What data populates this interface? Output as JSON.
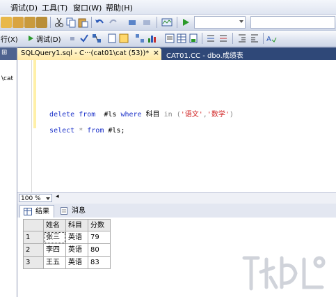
{
  "menu": [
    {
      "label": "调试(D)"
    },
    {
      "label": "工具(T)"
    },
    {
      "label": "窗口(W)"
    },
    {
      "label": "帮助(H)"
    }
  ],
  "toolbar2": {
    "execute_prefix": "行(X)",
    "debug_label": "调试(D)"
  },
  "left_panel": {
    "path_fragment": "\\cat"
  },
  "tabs": [
    {
      "label": "SQLQuery1.sql - C···(cat01\\cat (53))*"
    },
    {
      "label": "CAT01.CC - dbo.成绩表"
    }
  ],
  "close_glyph": "×",
  "editor": {
    "line1": {
      "kw1": "delete",
      "kw2": "from",
      "table": "#ls",
      "kw3": "where",
      "col": "科目",
      "kw4": "in",
      "lp": "(",
      "s1": "'语文'",
      "comma": ",",
      "s2": "'数学'",
      "rp": ")"
    },
    "line2": {
      "kw1": "select",
      "star": "*",
      "kw2": "from",
      "table": "#ls;"
    }
  },
  "zoom": {
    "value": "100 %"
  },
  "result_tabs": [
    {
      "label": "结果"
    },
    {
      "label": "消息"
    }
  ],
  "grid": {
    "columns": [
      "姓名",
      "科目",
      "分数"
    ],
    "rows": [
      {
        "num": "1",
        "cells": [
          "张三",
          "英语",
          "79"
        ]
      },
      {
        "num": "2",
        "cells": [
          "李四",
          "英语",
          "80"
        ]
      },
      {
        "num": "3",
        "cells": [
          "王五",
          "英语",
          "83"
        ]
      }
    ]
  },
  "colors": {
    "tab_strip": "#2f4878",
    "active_tab": "#ffe9a6",
    "keyword": "#1b31c9",
    "string": "#d02020"
  }
}
